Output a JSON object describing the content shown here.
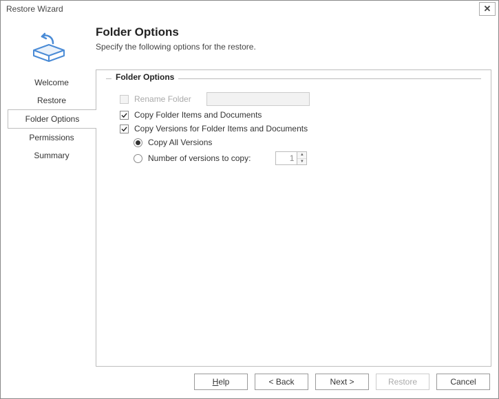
{
  "window": {
    "title": "Restore Wizard"
  },
  "header": {
    "title": "Folder Options",
    "subtitle": "Specify the following options for the restore."
  },
  "sidebar": {
    "items": [
      {
        "label": "Welcome",
        "selected": false
      },
      {
        "label": "Restore",
        "selected": false
      },
      {
        "label": "Folder Options",
        "selected": true
      },
      {
        "label": "Permissions",
        "selected": false
      },
      {
        "label": "Summary",
        "selected": false
      }
    ]
  },
  "options": {
    "legend": "Folder Options",
    "rename_folder": {
      "label": "Rename Folder",
      "checked": false,
      "enabled": false,
      "value": ""
    },
    "copy_items": {
      "label": "Copy Folder Items and Documents",
      "checked": true
    },
    "copy_versions": {
      "label": "Copy Versions for Folder Items and  Documents",
      "checked": true
    },
    "version_mode": {
      "all": {
        "label": "Copy All Versions",
        "selected": true
      },
      "number": {
        "label": "Number of versions to copy:",
        "selected": false,
        "value": "1"
      }
    }
  },
  "buttons": {
    "help": "Help",
    "back": "< Back",
    "next": "Next >",
    "restore": "Restore",
    "cancel": "Cancel"
  }
}
